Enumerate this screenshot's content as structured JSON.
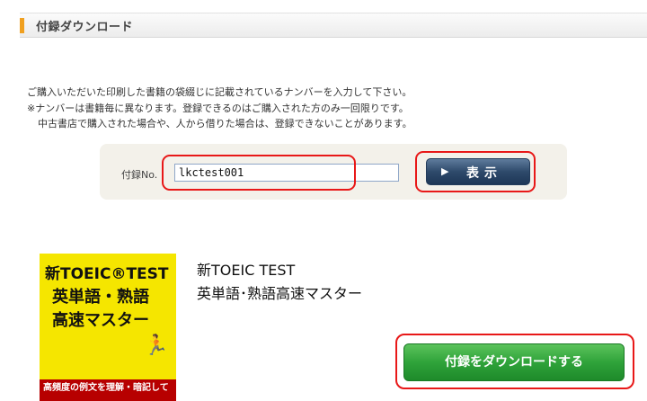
{
  "header": {
    "title": "付録ダウンロード"
  },
  "notice": {
    "line1": "ご購入いただいた印刷した書籍の袋綴じに記載されているナンバーを入力して下さい。",
    "line2": "※ナンバーは書籍毎に異なります。登録できるのはご購入された方のみ一回限りです。",
    "line3": "中古書店で購入された場合や、人から借りた場合は、登録できないことがあります。"
  },
  "form": {
    "label": "付録No.",
    "input_value": "lkctest001",
    "submit_label": "表示",
    "submit_icon": "play-triangle-icon"
  },
  "book": {
    "cover": {
      "line1": "新TOEIC®TEST",
      "line2": "英単語・熟語",
      "line3": "高速マスター",
      "band": "高頻度の例文を理解・暗記して"
    },
    "title_line1": "新TOEIC TEST",
    "title_line2": "英単語･熟語高速マスター"
  },
  "download": {
    "label": "付録をダウンロードする"
  },
  "colors": {
    "accent": "#f0a020",
    "highlight": "#e81818",
    "show_button": "#2e4a6b",
    "download_button": "#2fa33a"
  }
}
